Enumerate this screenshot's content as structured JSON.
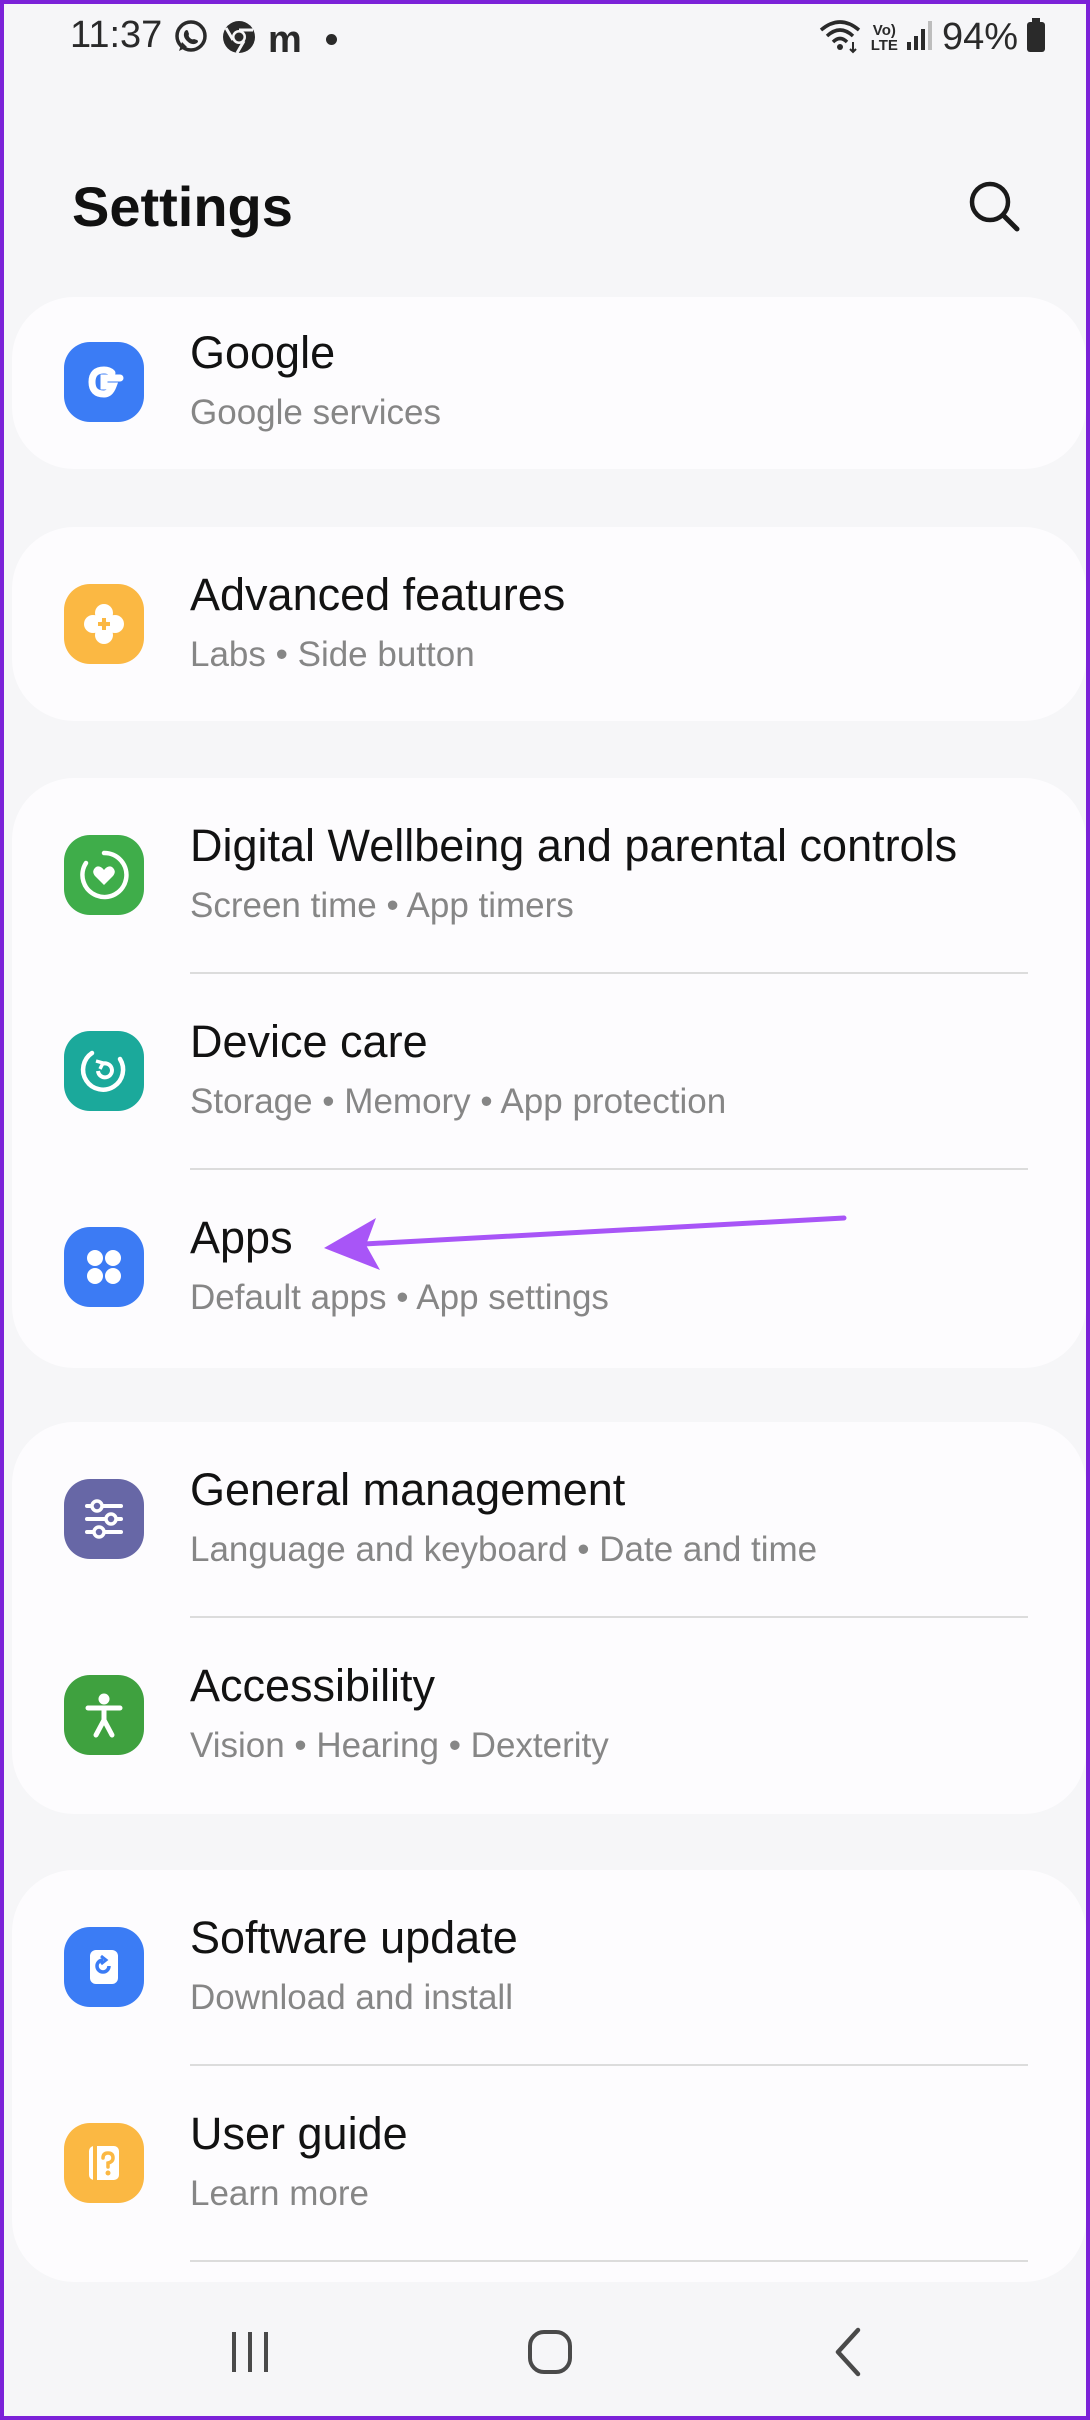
{
  "status_bar": {
    "time": "11:37",
    "volte_line1": "Vo)",
    "volte_line2": "LTE",
    "battery_text": "94%",
    "left_icons": [
      "whatsapp-icon",
      "chrome-icon",
      "m-app-icon"
    ],
    "right_icons": [
      "wifi-icon",
      "volte-icon",
      "signal-icon",
      "battery-icon"
    ]
  },
  "header": {
    "title": "Settings",
    "search_icon": "search-icon"
  },
  "groups": [
    {
      "items": [
        {
          "title": "Google",
          "subtitle": "Google services",
          "icon": "google-icon",
          "icon_color": "#3b7cf5"
        }
      ]
    },
    {
      "items": [
        {
          "title": "Advanced features",
          "subtitle": "Labs  •  Side button",
          "icon": "advanced-features-icon",
          "icon_color": "#fbb843"
        }
      ]
    },
    {
      "items": [
        {
          "title": "Digital Wellbeing and parental controls",
          "subtitle": "Screen time  •  App timers",
          "icon": "digital-wellbeing-icon",
          "icon_color": "#3fad4a"
        },
        {
          "title": "Device care",
          "subtitle": "Storage  •  Memory  •  App protection",
          "icon": "device-care-icon",
          "icon_color": "#1ba99b"
        },
        {
          "title": "Apps",
          "subtitle": "Default apps  •  App settings",
          "icon": "apps-icon",
          "icon_color": "#3c7bf4"
        }
      ]
    },
    {
      "items": [
        {
          "title": "General management",
          "subtitle": "Language and keyboard  •  Date and time",
          "icon": "general-management-icon",
          "icon_color": "#6767a6"
        },
        {
          "title": "Accessibility",
          "subtitle": "Vision  •  Hearing  •  Dexterity",
          "icon": "accessibility-icon",
          "icon_color": "#3fa13f"
        }
      ]
    },
    {
      "items": [
        {
          "title": "Software update",
          "subtitle": "Download and install",
          "icon": "software-update-icon",
          "icon_color": "#3b7cf5"
        },
        {
          "title": "User guide",
          "subtitle": "Learn more",
          "icon": "user-guide-icon",
          "icon_color": "#fbb843"
        }
      ]
    }
  ],
  "annotation": {
    "arrow_color": "#a855f7",
    "points_to": "Apps"
  },
  "nav_bar": {
    "buttons": [
      "recents-icon",
      "home-icon",
      "back-icon"
    ]
  }
}
